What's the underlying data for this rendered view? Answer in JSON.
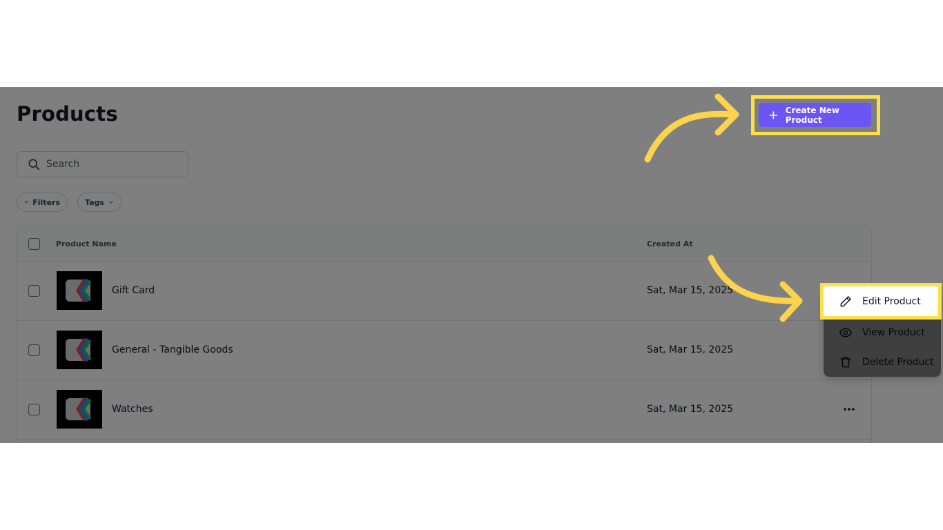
{
  "page": {
    "title": "Products",
    "create_button_label": "Create New Product",
    "search_placeholder": "Search",
    "filters_label": "Filters",
    "tags_label": "Tags"
  },
  "table": {
    "columns": [
      "Product Name",
      "Created At"
    ],
    "rows": [
      {
        "name": "Gift Card",
        "created_at": "Sat, Mar 15, 2025"
      },
      {
        "name": "General - Tangible Goods",
        "created_at": "Sat, Mar 15, 2025"
      },
      {
        "name": "Watches",
        "created_at": "Sat, Mar 15, 2025"
      }
    ]
  },
  "row_menu": {
    "items": [
      {
        "label": "Edit Product",
        "icon": "pencil-icon"
      },
      {
        "label": "View Product",
        "icon": "eye-icon"
      },
      {
        "label": "Delete Product",
        "icon": "trash-icon"
      }
    ]
  },
  "colors": {
    "accent": "#6b56f5",
    "highlight": "#fde047",
    "arrow": "#fcd34d"
  }
}
